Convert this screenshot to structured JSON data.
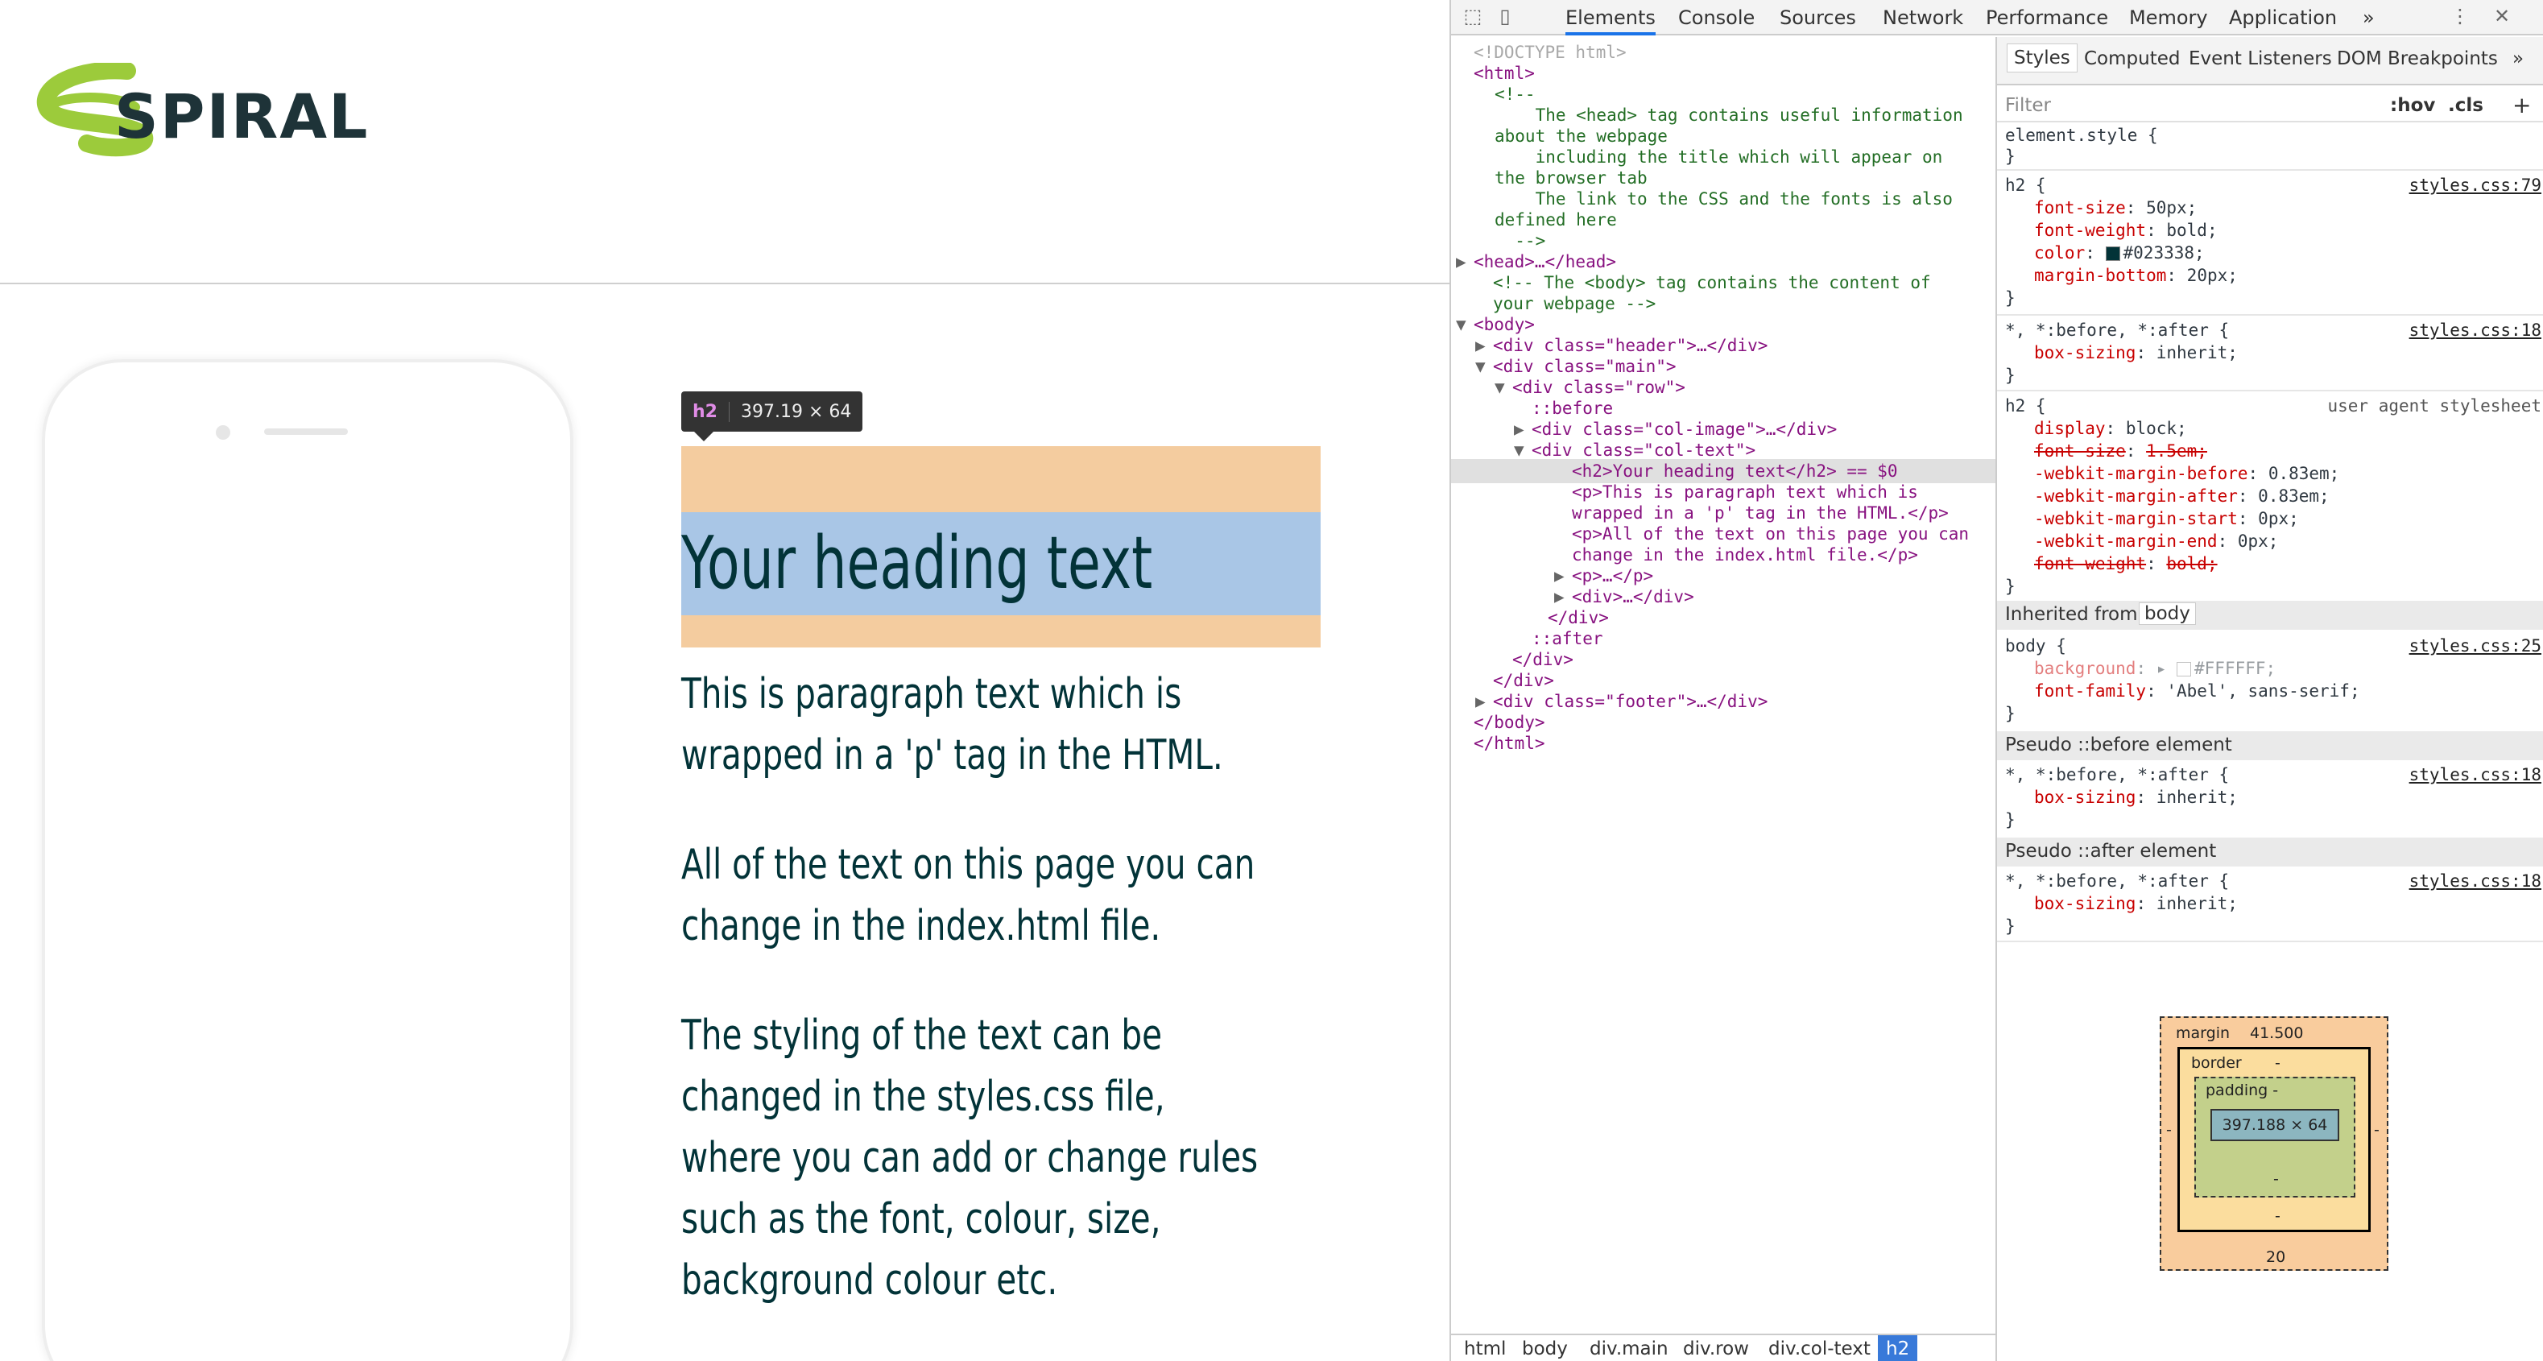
{
  "site": {
    "logo_text": "SPIRAL",
    "tooltip": {
      "tag": "h2",
      "dimensions": "397.19 × 64"
    },
    "heading": "Your heading text",
    "paragraphs": [
      [
        "This is paragraph text which is",
        "wrapped in a 'p' tag in the HTML."
      ],
      [
        "All of the text on this page you can",
        "change in the index.html file."
      ],
      [
        "The styling of the text can be",
        "changed in the styles.css file,",
        "where you can add or change rules",
        "such as the font, colour, size,",
        "background colour etc."
      ]
    ]
  },
  "devtools": {
    "tabs": [
      "Elements",
      "Console",
      "Sources",
      "Network",
      "Performance",
      "Memory",
      "Application",
      "»"
    ],
    "active_tab": "Elements",
    "elements_lines": [
      {
        "t": "<!DOCTYPE html>",
        "c": "gray"
      },
      {
        "t": "<html>",
        "c": "tag"
      },
      {
        "t": "<!--",
        "c": "comment"
      },
      {
        "t": "    The <head> tag contains useful information",
        "c": "comment"
      },
      {
        "t": "about the webpage",
        "c": "comment"
      },
      {
        "t": "    including the title which will appear on",
        "c": "comment"
      },
      {
        "t": "the browser tab",
        "c": "comment"
      },
      {
        "t": "    The link to the CSS and the fonts is also",
        "c": "comment"
      },
      {
        "t": "defined here",
        "c": "comment"
      },
      {
        "t": "  -->",
        "c": "comment"
      },
      {
        "t": "<head>…</head>",
        "c": "tag"
      },
      {
        "t": "<!-- The <body> tag contains the content of",
        "c": "comment"
      },
      {
        "t": "your webpage -->",
        "c": "comment"
      },
      {
        "t": "<body>",
        "c": "tag"
      },
      {
        "t": "<div class=\"header\">…</div>",
        "c": "tag"
      },
      {
        "t": "<div class=\"main\">",
        "c": "tag"
      },
      {
        "t": "<div class=\"row\">",
        "c": "tag"
      },
      {
        "t": "::before",
        "c": "tag"
      },
      {
        "t": "<div class=\"col-image\">…</div>",
        "c": "tag"
      },
      {
        "t": "<div class=\"col-text\">",
        "c": "tag"
      },
      {
        "t": "<h2>Your heading text</h2> == $0",
        "c": "tag"
      },
      {
        "t": "<p>This is paragraph text which is",
        "c": "tag"
      },
      {
        "t": "wrapped in a 'p' tag in the HTML.</p>",
        "c": "tag"
      },
      {
        "t": "<p>All of the text on this page you can",
        "c": "tag"
      },
      {
        "t": "change in the index.html file.</p>",
        "c": "tag"
      },
      {
        "t": "<p>…</p>",
        "c": "tag"
      },
      {
        "t": "<div>…</div>",
        "c": "tag"
      },
      {
        "t": "</div>",
        "c": "tag"
      },
      {
        "t": "::after",
        "c": "tag"
      },
      {
        "t": "</div>",
        "c": "tag"
      },
      {
        "t": "</div>",
        "c": "tag"
      },
      {
        "t": "<div class=\"footer\">…</div>",
        "c": "tag"
      },
      {
        "t": "</body>",
        "c": "tag"
      },
      {
        "t": "</html>",
        "c": "tag"
      }
    ],
    "breadcrumbs": [
      "html",
      "body",
      "div.main",
      "div.row",
      "div.col-text",
      "h2"
    ],
    "styles_tabs": [
      "Styles",
      "Computed",
      "Event Listeners",
      "DOM Breakpoints",
      "»"
    ],
    "filter_placeholder": "Filter",
    "filter_hov": ":hov",
    "filter_cls": ".cls",
    "filter_add": "+",
    "rules": {
      "element_style": "element.style {",
      "h2_selector": "h2 {",
      "h2_source": "styles.css:79",
      "h2_props": [
        [
          "font-size",
          "50px;"
        ],
        [
          "font-weight",
          "bold;"
        ],
        [
          "color",
          "#023338;"
        ],
        [
          "margin-bottom",
          "20px;"
        ]
      ],
      "star_selector": "*, *:before, *:after {",
      "star_source": "styles.css:18",
      "star_prop": [
        "box-sizing",
        "inherit;"
      ],
      "ua_selector": "h2 {",
      "ua_source": "user agent stylesheet",
      "ua_props": [
        [
          "display",
          "block;",
          false
        ],
        [
          "font-size",
          "1.5em;",
          true
        ],
        [
          "-webkit-margin-before",
          "0.83em;",
          false
        ],
        [
          "-webkit-margin-after",
          "0.83em;",
          false
        ],
        [
          "-webkit-margin-start",
          "0px;",
          false
        ],
        [
          "-webkit-margin-end",
          "0px;",
          false
        ],
        [
          "font-weight",
          "bold;",
          true
        ]
      ],
      "inherited_label": "Inherited from",
      "inherited_from": "body",
      "body_selector": "body {",
      "body_source": "styles.css:25",
      "body_props": [
        [
          "background",
          "#FFFFFF;"
        ],
        [
          "font-family",
          "'Abel', sans-serif;"
        ]
      ],
      "pseudo_before": "Pseudo ::before element",
      "pseudo_after": "Pseudo ::after element",
      "close_brace": "}"
    },
    "box_model": {
      "margin_label": "margin",
      "margin_top": "41.500",
      "border_label": "border",
      "border_val": "-",
      "padding_label": "padding -",
      "content": "397.188 × 64",
      "padding_bottom": "-",
      "border_bottom": "-",
      "margin_bottom": "20",
      "side": "-"
    },
    "colors": {
      "h2_color": "#023338",
      "body_bg": "#FFFFFF"
    }
  }
}
